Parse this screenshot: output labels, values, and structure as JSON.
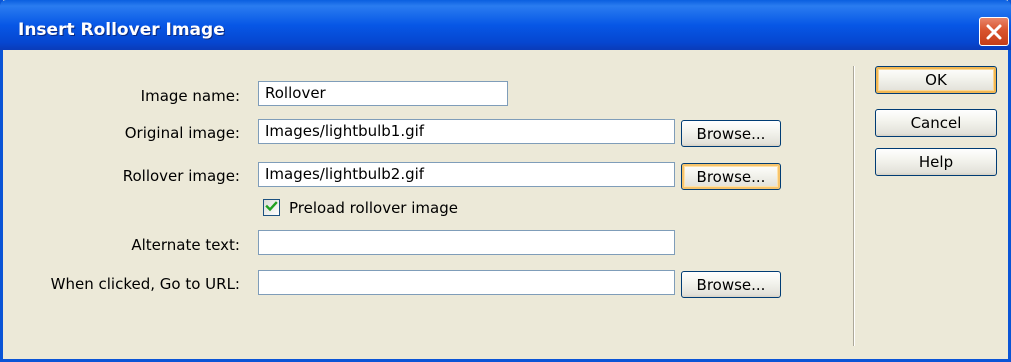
{
  "window": {
    "title": "Insert Rollover Image"
  },
  "form": {
    "image_name": {
      "label": "Image name:",
      "value": "Rollover"
    },
    "original_image": {
      "label": "Original image:",
      "value": "Images/lightbulb1.gif",
      "browse_label": "Browse..."
    },
    "rollover_image": {
      "label": "Rollover image:",
      "value": "Images/lightbulb2.gif",
      "browse_label": "Browse..."
    },
    "preload": {
      "label": "Preload rollover image",
      "checked": true
    },
    "alternate_text": {
      "label": "Alternate text:",
      "value": ""
    },
    "go_to_url": {
      "label": "When clicked, Go to URL:",
      "value": "",
      "browse_label": "Browse..."
    }
  },
  "buttons": {
    "ok": "OK",
    "cancel": "Cancel",
    "help": "Help"
  },
  "colors": {
    "titlebar": "#0757e6",
    "dialog_bg": "#ece9d8",
    "close": "#d9542e",
    "check": "#21a121"
  },
  "icons": {
    "close": "close-icon",
    "check": "checkmark-icon"
  }
}
